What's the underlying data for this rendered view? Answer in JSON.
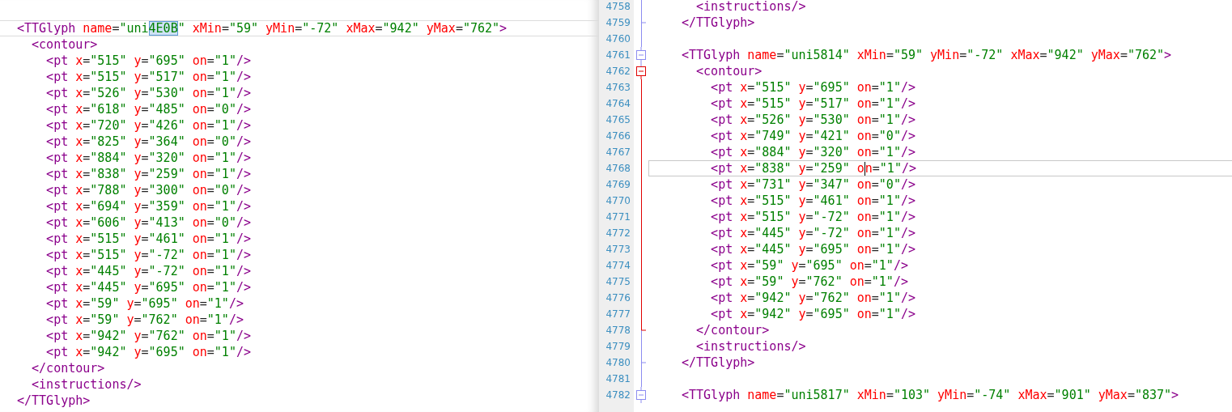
{
  "left_pane": {
    "lines": [
      {
        "current": true,
        "t": [
          {
            "kind": "tag",
            "text": "<TTGlyph"
          },
          {
            "kind": "attr",
            "text": " name"
          },
          {
            "kind": "punct",
            "text": "="
          },
          {
            "kind": "value",
            "text": "\"uni"
          },
          {
            "kind": "selected",
            "text": "4E0B"
          },
          {
            "kind": "value",
            "text": "\""
          },
          {
            "kind": "attr",
            "text": " xMin"
          },
          {
            "kind": "punct",
            "text": "="
          },
          {
            "kind": "value",
            "text": "\"59\""
          },
          {
            "kind": "attr",
            "text": " yMin"
          },
          {
            "kind": "punct",
            "text": "="
          },
          {
            "kind": "value",
            "text": "\"-72\""
          },
          {
            "kind": "attr",
            "text": " xMax"
          },
          {
            "kind": "punct",
            "text": "="
          },
          {
            "kind": "value",
            "text": "\"942\""
          },
          {
            "kind": "attr",
            "text": " yMax"
          },
          {
            "kind": "punct",
            "text": "="
          },
          {
            "kind": "value",
            "text": "\"762\""
          },
          {
            "kind": "tag",
            "text": ">"
          }
        ]
      },
      {
        "current": false,
        "t": [
          {
            "kind": "tag",
            "text": "  <contour>"
          }
        ]
      },
      {
        "current": false,
        "t": [
          {
            "kind": "tag",
            "text": "    <pt"
          },
          {
            "kind": "attr",
            "text": " x"
          },
          {
            "kind": "punct",
            "text": "="
          },
          {
            "kind": "value",
            "text": "\"515\""
          },
          {
            "kind": "attr",
            "text": " y"
          },
          {
            "kind": "punct",
            "text": "="
          },
          {
            "kind": "value",
            "text": "\"695\""
          },
          {
            "kind": "attr",
            "text": " on"
          },
          {
            "kind": "punct",
            "text": "="
          },
          {
            "kind": "value",
            "text": "\"1\""
          },
          {
            "kind": "tag",
            "text": "/>"
          }
        ]
      },
      {
        "current": false,
        "t": [
          {
            "kind": "tag",
            "text": "    <pt"
          },
          {
            "kind": "attr",
            "text": " x"
          },
          {
            "kind": "punct",
            "text": "="
          },
          {
            "kind": "value",
            "text": "\"515\""
          },
          {
            "kind": "attr",
            "text": " y"
          },
          {
            "kind": "punct",
            "text": "="
          },
          {
            "kind": "value",
            "text": "\"517\""
          },
          {
            "kind": "attr",
            "text": " on"
          },
          {
            "kind": "punct",
            "text": "="
          },
          {
            "kind": "value",
            "text": "\"1\""
          },
          {
            "kind": "tag",
            "text": "/>"
          }
        ]
      },
      {
        "current": false,
        "t": [
          {
            "kind": "tag",
            "text": "    <pt"
          },
          {
            "kind": "attr",
            "text": " x"
          },
          {
            "kind": "punct",
            "text": "="
          },
          {
            "kind": "value",
            "text": "\"526\""
          },
          {
            "kind": "attr",
            "text": " y"
          },
          {
            "kind": "punct",
            "text": "="
          },
          {
            "kind": "value",
            "text": "\"530\""
          },
          {
            "kind": "attr",
            "text": " on"
          },
          {
            "kind": "punct",
            "text": "="
          },
          {
            "kind": "value",
            "text": "\"1\""
          },
          {
            "kind": "tag",
            "text": "/>"
          }
        ]
      },
      {
        "current": false,
        "t": [
          {
            "kind": "tag",
            "text": "    <pt"
          },
          {
            "kind": "attr",
            "text": " x"
          },
          {
            "kind": "punct",
            "text": "="
          },
          {
            "kind": "value",
            "text": "\"618\""
          },
          {
            "kind": "attr",
            "text": " y"
          },
          {
            "kind": "punct",
            "text": "="
          },
          {
            "kind": "value",
            "text": "\"485\""
          },
          {
            "kind": "attr",
            "text": " on"
          },
          {
            "kind": "punct",
            "text": "="
          },
          {
            "kind": "value",
            "text": "\"0\""
          },
          {
            "kind": "tag",
            "text": "/>"
          }
        ]
      },
      {
        "current": false,
        "t": [
          {
            "kind": "tag",
            "text": "    <pt"
          },
          {
            "kind": "attr",
            "text": " x"
          },
          {
            "kind": "punct",
            "text": "="
          },
          {
            "kind": "value",
            "text": "\"720\""
          },
          {
            "kind": "attr",
            "text": " y"
          },
          {
            "kind": "punct",
            "text": "="
          },
          {
            "kind": "value",
            "text": "\"426\""
          },
          {
            "kind": "attr",
            "text": " on"
          },
          {
            "kind": "punct",
            "text": "="
          },
          {
            "kind": "value",
            "text": "\"1\""
          },
          {
            "kind": "tag",
            "text": "/>"
          }
        ]
      },
      {
        "current": false,
        "t": [
          {
            "kind": "tag",
            "text": "    <pt"
          },
          {
            "kind": "attr",
            "text": " x"
          },
          {
            "kind": "punct",
            "text": "="
          },
          {
            "kind": "value",
            "text": "\"825\""
          },
          {
            "kind": "attr",
            "text": " y"
          },
          {
            "kind": "punct",
            "text": "="
          },
          {
            "kind": "value",
            "text": "\"364\""
          },
          {
            "kind": "attr",
            "text": " on"
          },
          {
            "kind": "punct",
            "text": "="
          },
          {
            "kind": "value",
            "text": "\"0\""
          },
          {
            "kind": "tag",
            "text": "/>"
          }
        ]
      },
      {
        "current": false,
        "t": [
          {
            "kind": "tag",
            "text": "    <pt"
          },
          {
            "kind": "attr",
            "text": " x"
          },
          {
            "kind": "punct",
            "text": "="
          },
          {
            "kind": "value",
            "text": "\"884\""
          },
          {
            "kind": "attr",
            "text": " y"
          },
          {
            "kind": "punct",
            "text": "="
          },
          {
            "kind": "value",
            "text": "\"320\""
          },
          {
            "kind": "attr",
            "text": " on"
          },
          {
            "kind": "punct",
            "text": "="
          },
          {
            "kind": "value",
            "text": "\"1\""
          },
          {
            "kind": "tag",
            "text": "/>"
          }
        ]
      },
      {
        "current": false,
        "t": [
          {
            "kind": "tag",
            "text": "    <pt"
          },
          {
            "kind": "attr",
            "text": " x"
          },
          {
            "kind": "punct",
            "text": "="
          },
          {
            "kind": "value",
            "text": "\"838\""
          },
          {
            "kind": "attr",
            "text": " y"
          },
          {
            "kind": "punct",
            "text": "="
          },
          {
            "kind": "value",
            "text": "\"259\""
          },
          {
            "kind": "attr",
            "text": " on"
          },
          {
            "kind": "punct",
            "text": "="
          },
          {
            "kind": "value",
            "text": "\"1\""
          },
          {
            "kind": "tag",
            "text": "/>"
          }
        ]
      },
      {
        "current": false,
        "t": [
          {
            "kind": "tag",
            "text": "    <pt"
          },
          {
            "kind": "attr",
            "text": " x"
          },
          {
            "kind": "punct",
            "text": "="
          },
          {
            "kind": "value",
            "text": "\"788\""
          },
          {
            "kind": "attr",
            "text": " y"
          },
          {
            "kind": "punct",
            "text": "="
          },
          {
            "kind": "value",
            "text": "\"300\""
          },
          {
            "kind": "attr",
            "text": " on"
          },
          {
            "kind": "punct",
            "text": "="
          },
          {
            "kind": "value",
            "text": "\"0\""
          },
          {
            "kind": "tag",
            "text": "/>"
          }
        ]
      },
      {
        "current": false,
        "t": [
          {
            "kind": "tag",
            "text": "    <pt"
          },
          {
            "kind": "attr",
            "text": " x"
          },
          {
            "kind": "punct",
            "text": "="
          },
          {
            "kind": "value",
            "text": "\"694\""
          },
          {
            "kind": "attr",
            "text": " y"
          },
          {
            "kind": "punct",
            "text": "="
          },
          {
            "kind": "value",
            "text": "\"359\""
          },
          {
            "kind": "attr",
            "text": " on"
          },
          {
            "kind": "punct",
            "text": "="
          },
          {
            "kind": "value",
            "text": "\"1\""
          },
          {
            "kind": "tag",
            "text": "/>"
          }
        ]
      },
      {
        "current": false,
        "t": [
          {
            "kind": "tag",
            "text": "    <pt"
          },
          {
            "kind": "attr",
            "text": " x"
          },
          {
            "kind": "punct",
            "text": "="
          },
          {
            "kind": "value",
            "text": "\"606\""
          },
          {
            "kind": "attr",
            "text": " y"
          },
          {
            "kind": "punct",
            "text": "="
          },
          {
            "kind": "value",
            "text": "\"413\""
          },
          {
            "kind": "attr",
            "text": " on"
          },
          {
            "kind": "punct",
            "text": "="
          },
          {
            "kind": "value",
            "text": "\"0\""
          },
          {
            "kind": "tag",
            "text": "/>"
          }
        ]
      },
      {
        "current": false,
        "t": [
          {
            "kind": "tag",
            "text": "    <pt"
          },
          {
            "kind": "attr",
            "text": " x"
          },
          {
            "kind": "punct",
            "text": "="
          },
          {
            "kind": "value",
            "text": "\"515\""
          },
          {
            "kind": "attr",
            "text": " y"
          },
          {
            "kind": "punct",
            "text": "="
          },
          {
            "kind": "value",
            "text": "\"461\""
          },
          {
            "kind": "attr",
            "text": " on"
          },
          {
            "kind": "punct",
            "text": "="
          },
          {
            "kind": "value",
            "text": "\"1\""
          },
          {
            "kind": "tag",
            "text": "/>"
          }
        ]
      },
      {
        "current": false,
        "t": [
          {
            "kind": "tag",
            "text": "    <pt"
          },
          {
            "kind": "attr",
            "text": " x"
          },
          {
            "kind": "punct",
            "text": "="
          },
          {
            "kind": "value",
            "text": "\"515\""
          },
          {
            "kind": "attr",
            "text": " y"
          },
          {
            "kind": "punct",
            "text": "="
          },
          {
            "kind": "value",
            "text": "\"-72\""
          },
          {
            "kind": "attr",
            "text": " on"
          },
          {
            "kind": "punct",
            "text": "="
          },
          {
            "kind": "value",
            "text": "\"1\""
          },
          {
            "kind": "tag",
            "text": "/>"
          }
        ]
      },
      {
        "current": false,
        "t": [
          {
            "kind": "tag",
            "text": "    <pt"
          },
          {
            "kind": "attr",
            "text": " x"
          },
          {
            "kind": "punct",
            "text": "="
          },
          {
            "kind": "value",
            "text": "\"445\""
          },
          {
            "kind": "attr",
            "text": " y"
          },
          {
            "kind": "punct",
            "text": "="
          },
          {
            "kind": "value",
            "text": "\"-72\""
          },
          {
            "kind": "attr",
            "text": " on"
          },
          {
            "kind": "punct",
            "text": "="
          },
          {
            "kind": "value",
            "text": "\"1\""
          },
          {
            "kind": "tag",
            "text": "/>"
          }
        ]
      },
      {
        "current": false,
        "t": [
          {
            "kind": "tag",
            "text": "    <pt"
          },
          {
            "kind": "attr",
            "text": " x"
          },
          {
            "kind": "punct",
            "text": "="
          },
          {
            "kind": "value",
            "text": "\"445\""
          },
          {
            "kind": "attr",
            "text": " y"
          },
          {
            "kind": "punct",
            "text": "="
          },
          {
            "kind": "value",
            "text": "\"695\""
          },
          {
            "kind": "attr",
            "text": " on"
          },
          {
            "kind": "punct",
            "text": "="
          },
          {
            "kind": "value",
            "text": "\"1\""
          },
          {
            "kind": "tag",
            "text": "/>"
          }
        ]
      },
      {
        "current": false,
        "t": [
          {
            "kind": "tag",
            "text": "    <pt"
          },
          {
            "kind": "attr",
            "text": " x"
          },
          {
            "kind": "punct",
            "text": "="
          },
          {
            "kind": "value",
            "text": "\"59\""
          },
          {
            "kind": "attr",
            "text": " y"
          },
          {
            "kind": "punct",
            "text": "="
          },
          {
            "kind": "value",
            "text": "\"695\""
          },
          {
            "kind": "attr",
            "text": " on"
          },
          {
            "kind": "punct",
            "text": "="
          },
          {
            "kind": "value",
            "text": "\"1\""
          },
          {
            "kind": "tag",
            "text": "/>"
          }
        ]
      },
      {
        "current": false,
        "t": [
          {
            "kind": "tag",
            "text": "    <pt"
          },
          {
            "kind": "attr",
            "text": " x"
          },
          {
            "kind": "punct",
            "text": "="
          },
          {
            "kind": "value",
            "text": "\"59\""
          },
          {
            "kind": "attr",
            "text": " y"
          },
          {
            "kind": "punct",
            "text": "="
          },
          {
            "kind": "value",
            "text": "\"762\""
          },
          {
            "kind": "attr",
            "text": " on"
          },
          {
            "kind": "punct",
            "text": "="
          },
          {
            "kind": "value",
            "text": "\"1\""
          },
          {
            "kind": "tag",
            "text": "/>"
          }
        ]
      },
      {
        "current": false,
        "t": [
          {
            "kind": "tag",
            "text": "    <pt"
          },
          {
            "kind": "attr",
            "text": " x"
          },
          {
            "kind": "punct",
            "text": "="
          },
          {
            "kind": "value",
            "text": "\"942\""
          },
          {
            "kind": "attr",
            "text": " y"
          },
          {
            "kind": "punct",
            "text": "="
          },
          {
            "kind": "value",
            "text": "\"762\""
          },
          {
            "kind": "attr",
            "text": " on"
          },
          {
            "kind": "punct",
            "text": "="
          },
          {
            "kind": "value",
            "text": "\"1\""
          },
          {
            "kind": "tag",
            "text": "/>"
          }
        ]
      },
      {
        "current": false,
        "t": [
          {
            "kind": "tag",
            "text": "    <pt"
          },
          {
            "kind": "attr",
            "text": " x"
          },
          {
            "kind": "punct",
            "text": "="
          },
          {
            "kind": "value",
            "text": "\"942\""
          },
          {
            "kind": "attr",
            "text": " y"
          },
          {
            "kind": "punct",
            "text": "="
          },
          {
            "kind": "value",
            "text": "\"695\""
          },
          {
            "kind": "attr",
            "text": " on"
          },
          {
            "kind": "punct",
            "text": "="
          },
          {
            "kind": "value",
            "text": "\"1\""
          },
          {
            "kind": "tag",
            "text": "/>"
          }
        ]
      },
      {
        "current": false,
        "t": [
          {
            "kind": "tag",
            "text": "  </contour>"
          }
        ]
      },
      {
        "current": false,
        "t": [
          {
            "kind": "tag",
            "text": "  <instructions/>"
          }
        ]
      },
      {
        "current": false,
        "t": [
          {
            "kind": "tag",
            "text": "</TTGlyph>"
          }
        ]
      }
    ]
  },
  "right_pane": {
    "lines": [
      {
        "n": "4758",
        "kind": "line",
        "current": false,
        "t": [
          {
            "kind": "tag",
            "text": "  <instructions/>"
          }
        ]
      },
      {
        "n": "4759",
        "kind": "end",
        "current": false,
        "t": [
          {
            "kind": "tag",
            "text": "</TTGlyph>"
          }
        ]
      },
      {
        "n": "4760",
        "kind": "line",
        "current": false
      },
      {
        "n": "4761",
        "kind": "box",
        "current": false,
        "t": [
          {
            "kind": "tag",
            "text": "<TTGlyph"
          },
          {
            "kind": "attr",
            "text": " name"
          },
          {
            "kind": "punct",
            "text": "="
          },
          {
            "kind": "value",
            "text": "\"uni5814\""
          },
          {
            "kind": "attr",
            "text": " xMin"
          },
          {
            "kind": "punct",
            "text": "="
          },
          {
            "kind": "value",
            "text": "\"59\""
          },
          {
            "kind": "attr",
            "text": " yMin"
          },
          {
            "kind": "punct",
            "text": "="
          },
          {
            "kind": "value",
            "text": "\"-72\""
          },
          {
            "kind": "attr",
            "text": " xMax"
          },
          {
            "kind": "punct",
            "text": "="
          },
          {
            "kind": "value",
            "text": "\"942\""
          },
          {
            "kind": "attr",
            "text": " yMax"
          },
          {
            "kind": "punct",
            "text": "="
          },
          {
            "kind": "value",
            "text": "\"762\""
          },
          {
            "kind": "tag",
            "text": ">"
          }
        ]
      },
      {
        "n": "4762",
        "kind": "box_active",
        "current": false,
        "t": [
          {
            "kind": "tag",
            "text": "  <contour>"
          }
        ]
      },
      {
        "n": "4763",
        "kind": "line_active",
        "current": false,
        "t": [
          {
            "kind": "tag",
            "text": "    <pt"
          },
          {
            "kind": "attr",
            "text": " x"
          },
          {
            "kind": "punct",
            "text": "="
          },
          {
            "kind": "value",
            "text": "\"515\""
          },
          {
            "kind": "attr",
            "text": " y"
          },
          {
            "kind": "punct",
            "text": "="
          },
          {
            "kind": "value",
            "text": "\"695\""
          },
          {
            "kind": "attr",
            "text": " on"
          },
          {
            "kind": "punct",
            "text": "="
          },
          {
            "kind": "value",
            "text": "\"1\""
          },
          {
            "kind": "tag",
            "text": "/>"
          }
        ]
      },
      {
        "n": "4764",
        "kind": "line_active",
        "current": false,
        "t": [
          {
            "kind": "tag",
            "text": "    <pt"
          },
          {
            "kind": "attr",
            "text": " x"
          },
          {
            "kind": "punct",
            "text": "="
          },
          {
            "kind": "value",
            "text": "\"515\""
          },
          {
            "kind": "attr",
            "text": " y"
          },
          {
            "kind": "punct",
            "text": "="
          },
          {
            "kind": "value",
            "text": "\"517\""
          },
          {
            "kind": "attr",
            "text": " on"
          },
          {
            "kind": "punct",
            "text": "="
          },
          {
            "kind": "value",
            "text": "\"1\""
          },
          {
            "kind": "tag",
            "text": "/>"
          }
        ]
      },
      {
        "n": "4765",
        "kind": "line_active",
        "current": false,
        "t": [
          {
            "kind": "tag",
            "text": "    <pt"
          },
          {
            "kind": "attr",
            "text": " x"
          },
          {
            "kind": "punct",
            "text": "="
          },
          {
            "kind": "value",
            "text": "\"526\""
          },
          {
            "kind": "attr",
            "text": " y"
          },
          {
            "kind": "punct",
            "text": "="
          },
          {
            "kind": "value",
            "text": "\"530\""
          },
          {
            "kind": "attr",
            "text": " on"
          },
          {
            "kind": "punct",
            "text": "="
          },
          {
            "kind": "value",
            "text": "\"1\""
          },
          {
            "kind": "tag",
            "text": "/>"
          }
        ]
      },
      {
        "n": "4766",
        "kind": "line_active",
        "current": false,
        "t": [
          {
            "kind": "tag",
            "text": "    <pt"
          },
          {
            "kind": "attr",
            "text": " x"
          },
          {
            "kind": "punct",
            "text": "="
          },
          {
            "kind": "value",
            "text": "\"749\""
          },
          {
            "kind": "attr",
            "text": " y"
          },
          {
            "kind": "punct",
            "text": "="
          },
          {
            "kind": "value",
            "text": "\"421\""
          },
          {
            "kind": "attr",
            "text": " on"
          },
          {
            "kind": "punct",
            "text": "="
          },
          {
            "kind": "value",
            "text": "\"0\""
          },
          {
            "kind": "tag",
            "text": "/>"
          }
        ]
      },
      {
        "n": "4767",
        "kind": "line_active",
        "current": false,
        "t": [
          {
            "kind": "tag",
            "text": "    <pt"
          },
          {
            "kind": "attr",
            "text": " x"
          },
          {
            "kind": "punct",
            "text": "="
          },
          {
            "kind": "value",
            "text": "\"884\""
          },
          {
            "kind": "attr",
            "text": " y"
          },
          {
            "kind": "punct",
            "text": "="
          },
          {
            "kind": "value",
            "text": "\"320\""
          },
          {
            "kind": "attr",
            "text": " on"
          },
          {
            "kind": "punct",
            "text": "="
          },
          {
            "kind": "value",
            "text": "\"1\""
          },
          {
            "kind": "tag",
            "text": "/>"
          }
        ]
      },
      {
        "n": "4768",
        "kind": "line_active",
        "current": true,
        "t": [
          {
            "kind": "tag",
            "text": "    <pt"
          },
          {
            "kind": "attr",
            "text": " x"
          },
          {
            "kind": "punct",
            "text": "="
          },
          {
            "kind": "value",
            "text": "\"838\""
          },
          {
            "kind": "attr",
            "text": " y"
          },
          {
            "kind": "punct",
            "text": "="
          },
          {
            "kind": "value",
            "text": "\"259\""
          },
          {
            "kind": "attr",
            "text": " o"
          },
          {
            "kind": "caret"
          },
          {
            "kind": "attr",
            "text": "n"
          },
          {
            "kind": "punct",
            "text": "="
          },
          {
            "kind": "value",
            "text": "\"1\""
          },
          {
            "kind": "tag",
            "text": "/>"
          }
        ]
      },
      {
        "n": "4769",
        "kind": "line_active",
        "current": false,
        "t": [
          {
            "kind": "tag",
            "text": "    <pt"
          },
          {
            "kind": "attr",
            "text": " x"
          },
          {
            "kind": "punct",
            "text": "="
          },
          {
            "kind": "value",
            "text": "\"731\""
          },
          {
            "kind": "attr",
            "text": " y"
          },
          {
            "kind": "punct",
            "text": "="
          },
          {
            "kind": "value",
            "text": "\"347\""
          },
          {
            "kind": "attr",
            "text": " on"
          },
          {
            "kind": "punct",
            "text": "="
          },
          {
            "kind": "value",
            "text": "\"0\""
          },
          {
            "kind": "tag",
            "text": "/>"
          }
        ]
      },
      {
        "n": "4770",
        "kind": "line_active",
        "current": false,
        "t": [
          {
            "kind": "tag",
            "text": "    <pt"
          },
          {
            "kind": "attr",
            "text": " x"
          },
          {
            "kind": "punct",
            "text": "="
          },
          {
            "kind": "value",
            "text": "\"515\""
          },
          {
            "kind": "attr",
            "text": " y"
          },
          {
            "kind": "punct",
            "text": "="
          },
          {
            "kind": "value",
            "text": "\"461\""
          },
          {
            "kind": "attr",
            "text": " on"
          },
          {
            "kind": "punct",
            "text": "="
          },
          {
            "kind": "value",
            "text": "\"1\""
          },
          {
            "kind": "tag",
            "text": "/>"
          }
        ]
      },
      {
        "n": "4771",
        "kind": "line_active",
        "current": false,
        "t": [
          {
            "kind": "tag",
            "text": "    <pt"
          },
          {
            "kind": "attr",
            "text": " x"
          },
          {
            "kind": "punct",
            "text": "="
          },
          {
            "kind": "value",
            "text": "\"515\""
          },
          {
            "kind": "attr",
            "text": " y"
          },
          {
            "kind": "punct",
            "text": "="
          },
          {
            "kind": "value",
            "text": "\"-72\""
          },
          {
            "kind": "attr",
            "text": " on"
          },
          {
            "kind": "punct",
            "text": "="
          },
          {
            "kind": "value",
            "text": "\"1\""
          },
          {
            "kind": "tag",
            "text": "/>"
          }
        ]
      },
      {
        "n": "4772",
        "kind": "line_active",
        "current": false,
        "t": [
          {
            "kind": "tag",
            "text": "    <pt"
          },
          {
            "kind": "attr",
            "text": " x"
          },
          {
            "kind": "punct",
            "text": "="
          },
          {
            "kind": "value",
            "text": "\"445\""
          },
          {
            "kind": "attr",
            "text": " y"
          },
          {
            "kind": "punct",
            "text": "="
          },
          {
            "kind": "value",
            "text": "\"-72\""
          },
          {
            "kind": "attr",
            "text": " on"
          },
          {
            "kind": "punct",
            "text": "="
          },
          {
            "kind": "value",
            "text": "\"1\""
          },
          {
            "kind": "tag",
            "text": "/>"
          }
        ]
      },
      {
        "n": "4773",
        "kind": "line_active",
        "current": false,
        "t": [
          {
            "kind": "tag",
            "text": "    <pt"
          },
          {
            "kind": "attr",
            "text": " x"
          },
          {
            "kind": "punct",
            "text": "="
          },
          {
            "kind": "value",
            "text": "\"445\""
          },
          {
            "kind": "attr",
            "text": " y"
          },
          {
            "kind": "punct",
            "text": "="
          },
          {
            "kind": "value",
            "text": "\"695\""
          },
          {
            "kind": "attr",
            "text": " on"
          },
          {
            "kind": "punct",
            "text": "="
          },
          {
            "kind": "value",
            "text": "\"1\""
          },
          {
            "kind": "tag",
            "text": "/>"
          }
        ]
      },
      {
        "n": "4774",
        "kind": "line_active",
        "current": false,
        "t": [
          {
            "kind": "tag",
            "text": "    <pt"
          },
          {
            "kind": "attr",
            "text": " x"
          },
          {
            "kind": "punct",
            "text": "="
          },
          {
            "kind": "value",
            "text": "\"59\""
          },
          {
            "kind": "attr",
            "text": " y"
          },
          {
            "kind": "punct",
            "text": "="
          },
          {
            "kind": "value",
            "text": "\"695\""
          },
          {
            "kind": "attr",
            "text": " on"
          },
          {
            "kind": "punct",
            "text": "="
          },
          {
            "kind": "value",
            "text": "\"1\""
          },
          {
            "kind": "tag",
            "text": "/>"
          }
        ]
      },
      {
        "n": "4775",
        "kind": "line_active",
        "current": false,
        "t": [
          {
            "kind": "tag",
            "text": "    <pt"
          },
          {
            "kind": "attr",
            "text": " x"
          },
          {
            "kind": "punct",
            "text": "="
          },
          {
            "kind": "value",
            "text": "\"59\""
          },
          {
            "kind": "attr",
            "text": " y"
          },
          {
            "kind": "punct",
            "text": "="
          },
          {
            "kind": "value",
            "text": "\"762\""
          },
          {
            "kind": "attr",
            "text": " on"
          },
          {
            "kind": "punct",
            "text": "="
          },
          {
            "kind": "value",
            "text": "\"1\""
          },
          {
            "kind": "tag",
            "text": "/>"
          }
        ]
      },
      {
        "n": "4776",
        "kind": "line_active",
        "current": false,
        "t": [
          {
            "kind": "tag",
            "text": "    <pt"
          },
          {
            "kind": "attr",
            "text": " x"
          },
          {
            "kind": "punct",
            "text": "="
          },
          {
            "kind": "value",
            "text": "\"942\""
          },
          {
            "kind": "attr",
            "text": " y"
          },
          {
            "kind": "punct",
            "text": "="
          },
          {
            "kind": "value",
            "text": "\"762\""
          },
          {
            "kind": "attr",
            "text": " on"
          },
          {
            "kind": "punct",
            "text": "="
          },
          {
            "kind": "value",
            "text": "\"1\""
          },
          {
            "kind": "tag",
            "text": "/>"
          }
        ]
      },
      {
        "n": "4777",
        "kind": "line_active",
        "current": false,
        "t": [
          {
            "kind": "tag",
            "text": "    <pt"
          },
          {
            "kind": "attr",
            "text": " x"
          },
          {
            "kind": "punct",
            "text": "="
          },
          {
            "kind": "value",
            "text": "\"942\""
          },
          {
            "kind": "attr",
            "text": " y"
          },
          {
            "kind": "punct",
            "text": "="
          },
          {
            "kind": "value",
            "text": "\"695\""
          },
          {
            "kind": "attr",
            "text": " on"
          },
          {
            "kind": "punct",
            "text": "="
          },
          {
            "kind": "value",
            "text": "\"1\""
          },
          {
            "kind": "tag",
            "text": "/>"
          }
        ]
      },
      {
        "n": "4778",
        "kind": "end_active",
        "current": false,
        "t": [
          {
            "kind": "tag",
            "text": "  </contour>"
          }
        ]
      },
      {
        "n": "4779",
        "kind": "line",
        "current": false,
        "t": [
          {
            "kind": "tag",
            "text": "  <instructions/>"
          }
        ]
      },
      {
        "n": "4780",
        "kind": "end",
        "current": false,
        "t": [
          {
            "kind": "tag",
            "text": "</TTGlyph>"
          }
        ]
      },
      {
        "n": "4781",
        "kind": "line",
        "current": false
      },
      {
        "n": "4782",
        "kind": "box",
        "current": false,
        "t": [
          {
            "kind": "tag",
            "text": "<TTGlyph"
          },
          {
            "kind": "attr",
            "text": " name"
          },
          {
            "kind": "punct",
            "text": "="
          },
          {
            "kind": "value",
            "text": "\"uni5817\""
          },
          {
            "kind": "attr",
            "text": " xMin"
          },
          {
            "kind": "punct",
            "text": "="
          },
          {
            "kind": "value",
            "text": "\"103\""
          },
          {
            "kind": "attr",
            "text": " yMin"
          },
          {
            "kind": "punct",
            "text": "="
          },
          {
            "kind": "value",
            "text": "\"-74\""
          },
          {
            "kind": "attr",
            "text": " xMax"
          },
          {
            "kind": "punct",
            "text": "="
          },
          {
            "kind": "value",
            "text": "\"901\""
          },
          {
            "kind": "attr",
            "text": " yMax"
          },
          {
            "kind": "punct",
            "text": "="
          },
          {
            "kind": "value",
            "text": "\"837\""
          },
          {
            "kind": "tag",
            "text": ">"
          }
        ]
      }
    ]
  }
}
